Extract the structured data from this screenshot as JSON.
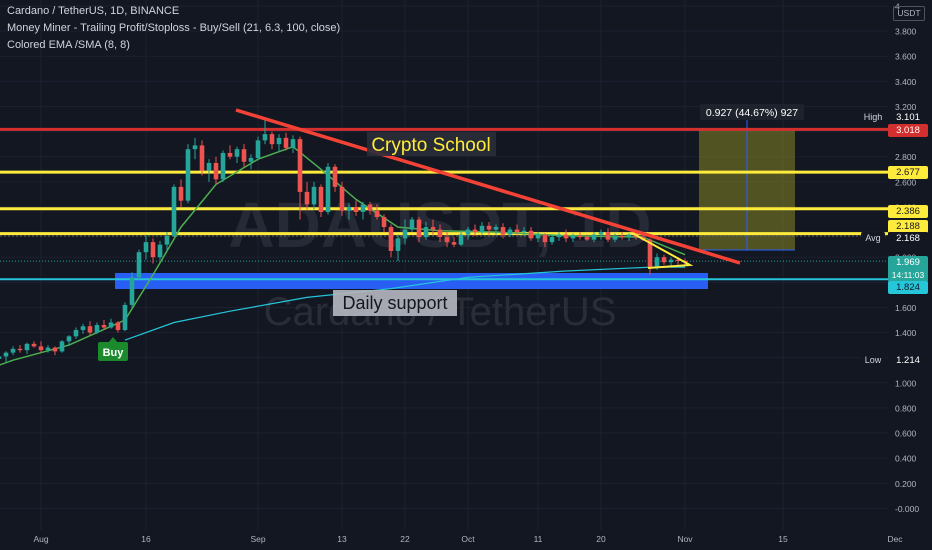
{
  "header": {
    "symbol_line": "Cardano / TetherUS, 1D, BINANCE",
    "indicator_1": "Money Miner - Trailing Profit/Stoploss - Buy/Sell (21, 6.3, 100, close)",
    "indicator_2": "Colored EMA /SMA (8, 8)",
    "currency": "USDT"
  },
  "watermark": {
    "ticker": "ADAUSDT, 1D",
    "name": "Cardano / TetherUS"
  },
  "annotations": {
    "crypto_school": "Crypto School",
    "daily_support": "Daily support",
    "buy_label": "Buy",
    "measure_label": "0.927 (44.67%) 927"
  },
  "price_tags": {
    "high_key": "High",
    "high_value": "3.101",
    "red_line": "3.018",
    "y1": "2.677",
    "y2": "2.386",
    "y3": "2.188",
    "avg_key": "Avg",
    "avg_value": "2.168",
    "last_price": "1.969",
    "countdown": "14:11:03",
    "cyan_line": "1.824",
    "low_key": "Low",
    "low_value": "1.214"
  },
  "colors": {
    "background": "#131722",
    "up": "#26a69a",
    "down": "#ef5350",
    "ema_green": "#4caf50",
    "sma_cyan": "#26c6da",
    "red_resistance": "#d32f2f",
    "yellow_levels": "#ffeb3b",
    "trend_line": "#f44336",
    "support_zone": "#2962ff",
    "measure_box": "#9e9d24",
    "buy_badge": "#1b8a2d"
  },
  "chart_data": {
    "type": "candlestick",
    "y_axis_ticks": [
      "4",
      "3.800",
      "3.600",
      "3.400",
      "3.200",
      "3.000",
      "2.800",
      "2.600",
      "2.400",
      "2.200",
      "2.000",
      "1.800",
      "1.600",
      "1.400",
      "1.200",
      "1.000",
      "0.800",
      "0.600",
      "0.400",
      "0.200",
      "-0.000"
    ],
    "y_range": [
      -0.06,
      4.0
    ],
    "x_axis_ticks": [
      "Aug",
      "16",
      "Sep",
      "13",
      "22",
      "Oct",
      "11",
      "20",
      "Nov",
      "15",
      "Dec"
    ],
    "x_tick_dates": [
      "2021-08-01",
      "2021-08-16",
      "2021-09-01",
      "2021-09-13",
      "2021-09-22",
      "2021-10-01",
      "2021-10-11",
      "2021-10-20",
      "2021-11-01",
      "2021-11-15",
      "2021-12-01"
    ],
    "levels": {
      "red_resistance": 3.018,
      "yellow": [
        2.677,
        2.386,
        2.188
      ],
      "cyan_support": 1.824,
      "support_zone": [
        1.785,
        1.905
      ],
      "high": 3.101,
      "low": 1.214
    },
    "trend_line": {
      "from": [
        "2021-08-29",
        3.16
      ],
      "to": [
        "2021-11-05",
        2.0
      ]
    },
    "measure_box": {
      "from_date": "2021-11-02",
      "to_date": "2021-11-14",
      "from_price": 2.168,
      "to_price": 3.101,
      "change": 0.927,
      "percent": 44.67
    },
    "daily_ohlc": [
      [
        "2021-07-20",
        1.06,
        1.08,
        1.01,
        1.03
      ],
      [
        "2021-07-21",
        1.03,
        1.12,
        1.02,
        1.1
      ],
      [
        "2021-07-22",
        1.1,
        1.14,
        1.08,
        1.11
      ],
      [
        "2021-07-23",
        1.11,
        1.2,
        1.1,
        1.18
      ],
      [
        "2021-07-24",
        1.18,
        1.22,
        1.15,
        1.2
      ],
      [
        "2021-07-25",
        1.2,
        1.22,
        1.17,
        1.19
      ],
      [
        "2021-07-26",
        1.19,
        1.28,
        1.17,
        1.21
      ],
      [
        "2021-07-27",
        1.21,
        1.25,
        1.16,
        1.24
      ],
      [
        "2021-07-28",
        1.24,
        1.29,
        1.22,
        1.27
      ],
      [
        "2021-07-29",
        1.27,
        1.3,
        1.24,
        1.26
      ],
      [
        "2021-07-30",
        1.26,
        1.32,
        1.23,
        1.31
      ],
      [
        "2021-07-31",
        1.31,
        1.33,
        1.28,
        1.29
      ],
      [
        "2021-08-01",
        1.29,
        1.33,
        1.24,
        1.26
      ],
      [
        "2021-08-02",
        1.26,
        1.3,
        1.24,
        1.28
      ],
      [
        "2021-08-03",
        1.28,
        1.29,
        1.22,
        1.25
      ],
      [
        "2021-08-04",
        1.25,
        1.34,
        1.24,
        1.33
      ],
      [
        "2021-08-05",
        1.33,
        1.38,
        1.3,
        1.37
      ],
      [
        "2021-08-06",
        1.37,
        1.44,
        1.35,
        1.42
      ],
      [
        "2021-08-07",
        1.42,
        1.47,
        1.39,
        1.45
      ],
      [
        "2021-08-08",
        1.45,
        1.49,
        1.38,
        1.4
      ],
      [
        "2021-08-09",
        1.4,
        1.48,
        1.39,
        1.46
      ],
      [
        "2021-08-10",
        1.46,
        1.5,
        1.42,
        1.44
      ],
      [
        "2021-08-11",
        1.44,
        1.51,
        1.43,
        1.48
      ],
      [
        "2021-08-12",
        1.48,
        1.49,
        1.4,
        1.42
      ],
      [
        "2021-08-13",
        1.42,
        1.64,
        1.41,
        1.62
      ],
      [
        "2021-08-14",
        1.62,
        1.88,
        1.6,
        1.84
      ],
      [
        "2021-08-15",
        1.84,
        2.06,
        1.82,
        2.04
      ],
      [
        "2021-08-16",
        2.04,
        2.18,
        1.98,
        2.12
      ],
      [
        "2021-08-17",
        2.12,
        2.15,
        1.95,
        2.0
      ],
      [
        "2021-08-18",
        2.0,
        2.13,
        1.98,
        2.1
      ],
      [
        "2021-08-19",
        2.1,
        2.2,
        2.05,
        2.17
      ],
      [
        "2021-08-20",
        2.17,
        2.58,
        2.16,
        2.56
      ],
      [
        "2021-08-21",
        2.56,
        2.62,
        2.4,
        2.45
      ],
      [
        "2021-08-22",
        2.45,
        2.9,
        2.43,
        2.86
      ],
      [
        "2021-08-23",
        2.86,
        2.95,
        2.78,
        2.89
      ],
      [
        "2021-08-24",
        2.89,
        2.93,
        2.65,
        2.69
      ],
      [
        "2021-08-25",
        2.69,
        2.78,
        2.6,
        2.75
      ],
      [
        "2021-08-26",
        2.75,
        2.8,
        2.58,
        2.62
      ],
      [
        "2021-08-27",
        2.62,
        2.85,
        2.6,
        2.83
      ],
      [
        "2021-08-28",
        2.83,
        2.89,
        2.78,
        2.8
      ],
      [
        "2021-08-29",
        2.8,
        2.88,
        2.75,
        2.86
      ],
      [
        "2021-08-30",
        2.86,
        2.9,
        2.72,
        2.76
      ],
      [
        "2021-08-31",
        2.76,
        2.82,
        2.7,
        2.79
      ],
      [
        "2021-09-01",
        2.79,
        2.96,
        2.77,
        2.93
      ],
      [
        "2021-09-02",
        2.93,
        3.1,
        2.9,
        2.98
      ],
      [
        "2021-09-03",
        2.98,
        3.0,
        2.86,
        2.9
      ],
      [
        "2021-09-04",
        2.9,
        2.98,
        2.84,
        2.95
      ],
      [
        "2021-09-05",
        2.95,
        2.99,
        2.85,
        2.87
      ],
      [
        "2021-09-06",
        2.87,
        2.97,
        2.83,
        2.94
      ],
      [
        "2021-09-07",
        2.94,
        2.96,
        2.3,
        2.52
      ],
      [
        "2021-09-08",
        2.52,
        2.6,
        2.38,
        2.42
      ],
      [
        "2021-09-09",
        2.42,
        2.6,
        2.38,
        2.56
      ],
      [
        "2021-09-10",
        2.56,
        2.58,
        2.32,
        2.36
      ],
      [
        "2021-09-11",
        2.36,
        2.75,
        2.34,
        2.72
      ],
      [
        "2021-09-12",
        2.72,
        2.74,
        2.52,
        2.56
      ],
      [
        "2021-09-13",
        2.56,
        2.6,
        2.33,
        2.37
      ],
      [
        "2021-09-14",
        2.37,
        2.43,
        2.3,
        2.4
      ],
      [
        "2021-09-15",
        2.4,
        2.45,
        2.33,
        2.36
      ],
      [
        "2021-09-16",
        2.36,
        2.44,
        2.3,
        2.42
      ],
      [
        "2021-09-17",
        2.42,
        2.44,
        2.34,
        2.37
      ],
      [
        "2021-09-18",
        2.37,
        2.42,
        2.3,
        2.32
      ],
      [
        "2021-09-19",
        2.32,
        2.34,
        2.2,
        2.24
      ],
      [
        "2021-09-20",
        2.24,
        2.26,
        2.0,
        2.05
      ],
      [
        "2021-09-21",
        2.05,
        2.18,
        1.97,
        2.15
      ],
      [
        "2021-09-22",
        2.15,
        2.3,
        2.1,
        2.22
      ],
      [
        "2021-09-23",
        2.22,
        2.32,
        2.2,
        2.3
      ],
      [
        "2021-09-24",
        2.3,
        2.32,
        2.12,
        2.16
      ],
      [
        "2021-09-25",
        2.16,
        2.28,
        2.14,
        2.24
      ],
      [
        "2021-09-26",
        2.24,
        2.3,
        2.18,
        2.22
      ],
      [
        "2021-09-27",
        2.22,
        2.26,
        2.12,
        2.16
      ],
      [
        "2021-09-28",
        2.16,
        2.2,
        2.08,
        2.12
      ],
      [
        "2021-09-29",
        2.12,
        2.16,
        2.08,
        2.1
      ],
      [
        "2021-09-30",
        2.1,
        2.2,
        2.09,
        2.18
      ],
      [
        "2021-10-01",
        2.18,
        2.24,
        2.14,
        2.22
      ],
      [
        "2021-10-02",
        2.22,
        2.26,
        2.17,
        2.2
      ],
      [
        "2021-10-03",
        2.2,
        2.28,
        2.18,
        2.25
      ],
      [
        "2021-10-04",
        2.25,
        2.28,
        2.18,
        2.22
      ],
      [
        "2021-10-05",
        2.22,
        2.26,
        2.18,
        2.24
      ],
      [
        "2021-10-06",
        2.24,
        2.27,
        2.15,
        2.18
      ],
      [
        "2021-10-07",
        2.18,
        2.24,
        2.16,
        2.22
      ],
      [
        "2021-10-08",
        2.22,
        2.26,
        2.18,
        2.2
      ],
      [
        "2021-10-09",
        2.2,
        2.24,
        2.17,
        2.21
      ],
      [
        "2021-10-10",
        2.21,
        2.24,
        2.13,
        2.15
      ],
      [
        "2021-10-11",
        2.15,
        2.2,
        2.12,
        2.18
      ],
      [
        "2021-10-12",
        2.18,
        2.19,
        2.08,
        2.12
      ],
      [
        "2021-10-13",
        2.12,
        2.18,
        2.1,
        2.16
      ],
      [
        "2021-10-14",
        2.16,
        2.2,
        2.13,
        2.18
      ],
      [
        "2021-10-15",
        2.18,
        2.22,
        2.12,
        2.15
      ],
      [
        "2021-10-16",
        2.15,
        2.19,
        2.12,
        2.17
      ],
      [
        "2021-10-17",
        2.17,
        2.2,
        2.14,
        2.16
      ],
      [
        "2021-10-18",
        2.16,
        2.18,
        2.13,
        2.14
      ],
      [
        "2021-10-19",
        2.14,
        2.2,
        2.12,
        2.18
      ],
      [
        "2021-10-20",
        2.18,
        2.22,
        2.14,
        2.2
      ],
      [
        "2021-10-21",
        2.2,
        2.23,
        2.12,
        2.14
      ],
      [
        "2021-10-22",
        2.14,
        2.19,
        2.12,
        2.17
      ],
      [
        "2021-10-23",
        2.17,
        2.2,
        2.14,
        2.16
      ],
      [
        "2021-10-24",
        2.16,
        2.19,
        2.13,
        2.18
      ],
      [
        "2021-10-25",
        2.18,
        2.21,
        2.14,
        2.16
      ],
      [
        "2021-10-26",
        2.16,
        2.19,
        2.13,
        2.14
      ],
      [
        "2021-10-27",
        2.14,
        2.15,
        1.86,
        1.92
      ],
      [
        "2021-10-28",
        1.92,
        2.03,
        1.9,
        2.0
      ],
      [
        "2021-10-29",
        2.0,
        2.02,
        1.94,
        1.96
      ],
      [
        "2021-10-30",
        1.96,
        2.0,
        1.93,
        1.98
      ],
      [
        "2021-10-31",
        1.98,
        2.0,
        1.94,
        1.97
      ],
      [
        "2021-11-01",
        1.97,
        1.99,
        1.94,
        1.969
      ]
    ],
    "series_lines": [
      {
        "name": "Colored EMA /SMA (8, 8)",
        "points": [
          [
            "2021-07-20",
            1.02
          ],
          [
            "2021-07-28",
            1.18
          ],
          [
            "2021-08-05",
            1.3
          ],
          [
            "2021-08-13",
            1.5
          ],
          [
            "2021-08-17",
            1.86
          ],
          [
            "2021-08-21",
            2.24
          ],
          [
            "2021-08-26",
            2.58
          ],
          [
            "2021-09-01",
            2.78
          ],
          [
            "2021-09-06",
            2.88
          ],
          [
            "2021-09-10",
            2.7
          ],
          [
            "2021-09-15",
            2.46
          ],
          [
            "2021-09-21",
            2.24
          ],
          [
            "2021-09-27",
            2.21
          ],
          [
            "2021-10-05",
            2.2
          ],
          [
            "2021-10-15",
            2.17
          ],
          [
            "2021-10-26",
            2.16
          ],
          [
            "2021-11-01",
            2.02
          ]
        ]
      },
      {
        "name": "Money Miner - Trailing Profit/Stoploss",
        "points": [
          [
            "2021-08-13",
            1.34
          ],
          [
            "2021-08-20",
            1.48
          ],
          [
            "2021-08-28",
            1.57
          ],
          [
            "2021-09-08",
            1.68
          ],
          [
            "2021-09-20",
            1.75
          ],
          [
            "2021-10-01",
            1.84
          ],
          [
            "2021-10-15",
            1.89
          ],
          [
            "2021-10-27",
            1.92
          ],
          [
            "2021-11-01",
            1.92
          ]
        ]
      }
    ]
  }
}
